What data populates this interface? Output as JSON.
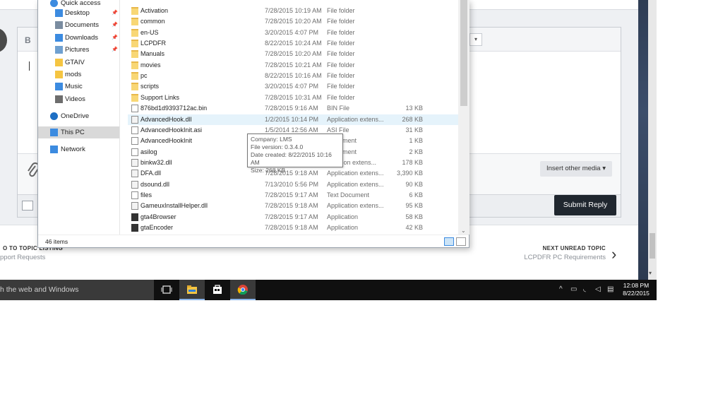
{
  "forum": {
    "bold_label": "B",
    "insert_other_media": "Insert other media ▾",
    "submit_reply": "Submit Reply",
    "prev_topic_label": "O TO TOPIC LISTING",
    "prev_topic_sub": "pport Requests",
    "next_topic_label": "NEXT UNREAD TOPIC",
    "next_topic_sub": "LCPDFR PC Requirements"
  },
  "explorer": {
    "nav": [
      {
        "label": "Quick access",
        "icon": "star-icon",
        "pinned": false,
        "type": "top"
      },
      {
        "label": "Desktop",
        "icon": "desktop-icon",
        "pinned": true,
        "type": "sub"
      },
      {
        "label": "Documents",
        "icon": "documents-icon",
        "pinned": true,
        "type": "sub"
      },
      {
        "label": "Downloads",
        "icon": "downloads-icon",
        "pinned": true,
        "type": "sub"
      },
      {
        "label": "Pictures",
        "icon": "pictures-icon",
        "pinned": true,
        "type": "sub"
      },
      {
        "label": "GTAIV",
        "icon": "folder-icon",
        "pinned": false,
        "type": "sub"
      },
      {
        "label": "mods",
        "icon": "folder-icon",
        "pinned": false,
        "type": "sub"
      },
      {
        "label": "Music",
        "icon": "music-icon",
        "pinned": false,
        "type": "sub"
      },
      {
        "label": "Videos",
        "icon": "videos-icon",
        "pinned": false,
        "type": "sub"
      },
      {
        "label": "OneDrive",
        "icon": "onedrive-icon",
        "pinned": false,
        "type": "top"
      },
      {
        "label": "This PC",
        "icon": "computer-icon",
        "pinned": false,
        "type": "top",
        "selected": true
      },
      {
        "label": "Network",
        "icon": "network-icon",
        "pinned": false,
        "type": "top"
      }
    ],
    "files": [
      {
        "name": "Activation",
        "date": "7/28/2015 10:19 AM",
        "type": "File folder",
        "size": "",
        "icon": "folder"
      },
      {
        "name": "common",
        "date": "7/28/2015 10:20 AM",
        "type": "File folder",
        "size": "",
        "icon": "folder"
      },
      {
        "name": "en-US",
        "date": "3/20/2015 4:07 PM",
        "type": "File folder",
        "size": "",
        "icon": "folder"
      },
      {
        "name": "LCPDFR",
        "date": "8/22/2015 10:24 AM",
        "type": "File folder",
        "size": "",
        "icon": "folder"
      },
      {
        "name": "Manuals",
        "date": "7/28/2015 10:20 AM",
        "type": "File folder",
        "size": "",
        "icon": "folder"
      },
      {
        "name": "movies",
        "date": "7/28/2015 10:21 AM",
        "type": "File folder",
        "size": "",
        "icon": "folder"
      },
      {
        "name": "pc",
        "date": "8/22/2015 10:16 AM",
        "type": "File folder",
        "size": "",
        "icon": "folder"
      },
      {
        "name": "scripts",
        "date": "3/20/2015 4:07 PM",
        "type": "File folder",
        "size": "",
        "icon": "folder"
      },
      {
        "name": "Support Links",
        "date": "7/28/2015 10:31 AM",
        "type": "File folder",
        "size": "",
        "icon": "folder"
      },
      {
        "name": "876bd1d9393712ac.bin",
        "date": "7/28/2015 9:16 AM",
        "type": "BIN File",
        "size": "13 KB",
        "icon": "file"
      },
      {
        "name": "AdvancedHook.dll",
        "date": "1/2/2015 10:14 PM",
        "type": "Application extens...",
        "size": "268 KB",
        "icon": "dll",
        "hover": true
      },
      {
        "name": "AdvancedHookInit.asi",
        "date": "1/5/2014 12:56 AM",
        "type": "ASI File",
        "size": "31 KB",
        "icon": "file"
      },
      {
        "name": "AdvancedHookInit",
        "date": "",
        "type": "...ocument",
        "size": "1 KB",
        "icon": "file"
      },
      {
        "name": "asilog",
        "date": "",
        "type": "...ocument",
        "size": "2 KB",
        "icon": "file"
      },
      {
        "name": "binkw32.dll",
        "date": "",
        "type": "...ication extens...",
        "size": "178 KB",
        "icon": "dll"
      },
      {
        "name": "DFA.dll",
        "date": "7/28/2015 9:18 AM",
        "type": "Application extens...",
        "size": "3,390 KB",
        "icon": "dll"
      },
      {
        "name": "dsound.dll",
        "date": "7/13/2010 5:56 PM",
        "type": "Application extens...",
        "size": "90 KB",
        "icon": "dll"
      },
      {
        "name": "files",
        "date": "7/28/2015 9:17 AM",
        "type": "Text Document",
        "size": "6 KB",
        "icon": "file"
      },
      {
        "name": "GameuxInstallHelper.dll",
        "date": "7/28/2015 9:18 AM",
        "type": "Application extens...",
        "size": "95 KB",
        "icon": "dll"
      },
      {
        "name": "gta4Browser",
        "date": "7/28/2015 9:17 AM",
        "type": "Application",
        "size": "58 KB",
        "icon": "app"
      },
      {
        "name": "gtaEncoder",
        "date": "7/28/2015 9:18 AM",
        "type": "Application",
        "size": "42 KB",
        "icon": "app"
      }
    ],
    "items_count": "46 items",
    "tooltip": {
      "company": "Company: LMS",
      "version": "File version: 0.3.4.0",
      "created": "Date created: 8/22/2015 10:16 AM",
      "size": "Size: 268 KB"
    }
  },
  "taskbar": {
    "search_text": "h the web and Windows",
    "time": "12:08 PM",
    "date": "8/22/2015"
  }
}
